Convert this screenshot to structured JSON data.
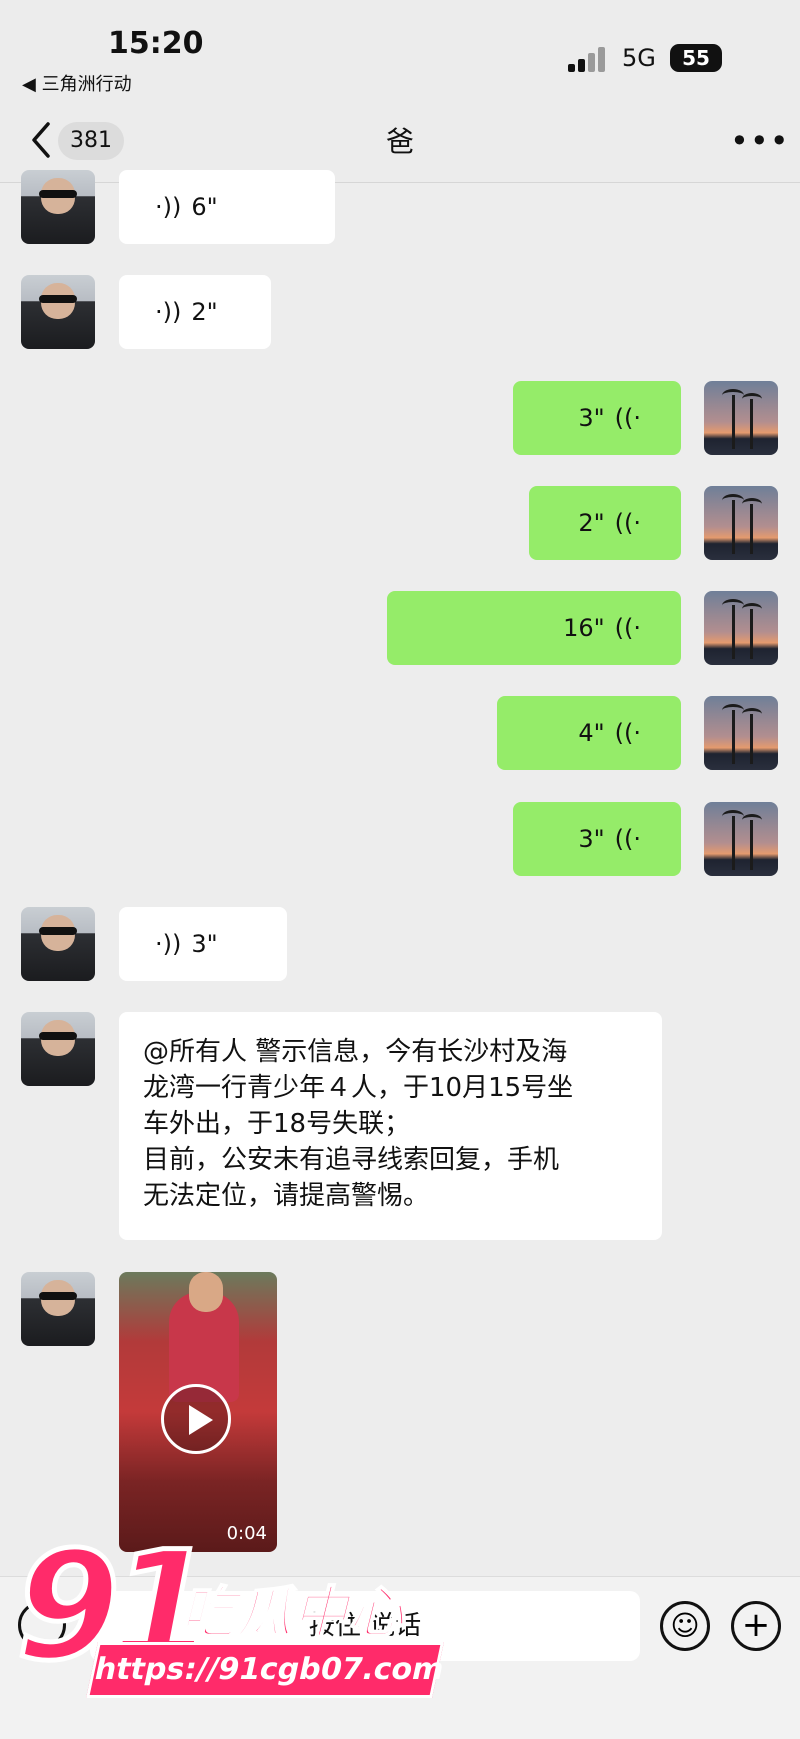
{
  "status": {
    "time": "15:20",
    "back_app": "◀ 三角洲行动",
    "network": "5G",
    "battery": "55"
  },
  "nav": {
    "unread_count": "381",
    "title": "爸",
    "more": "•••"
  },
  "messages": [
    {
      "side": "in",
      "type": "voice",
      "duration": "6\""
    },
    {
      "side": "in",
      "type": "voice",
      "duration": "2\""
    },
    {
      "side": "out",
      "type": "voice",
      "duration": "3\""
    },
    {
      "side": "out",
      "type": "voice",
      "duration": "2\""
    },
    {
      "side": "out",
      "type": "voice",
      "duration": "16\""
    },
    {
      "side": "out",
      "type": "voice",
      "duration": "4\""
    },
    {
      "side": "out",
      "type": "voice",
      "duration": "3\""
    },
    {
      "side": "in",
      "type": "voice",
      "duration": "3\""
    },
    {
      "side": "in",
      "type": "text",
      "text": "@所有人 警示信息，今有长沙村及海\n龙湾一行青少年４人，于10月15号坐\n车外出，于18号失联；\n目前，公安未有追寻线索回复，手机\n无法定位，请提高警惕。"
    },
    {
      "side": "in",
      "type": "video",
      "duration": "0:04"
    }
  ],
  "input": {
    "hold_to_talk": "按住 说话"
  },
  "watermark": {
    "number": "91",
    "name": "吃瓜中心",
    "url": "https://91cgb07.com"
  },
  "colors": {
    "outgoing_bubble": "#95ec69",
    "incoming_bubble": "#ffffff",
    "background": "#ededed",
    "watermark": "#ff2b6a"
  }
}
